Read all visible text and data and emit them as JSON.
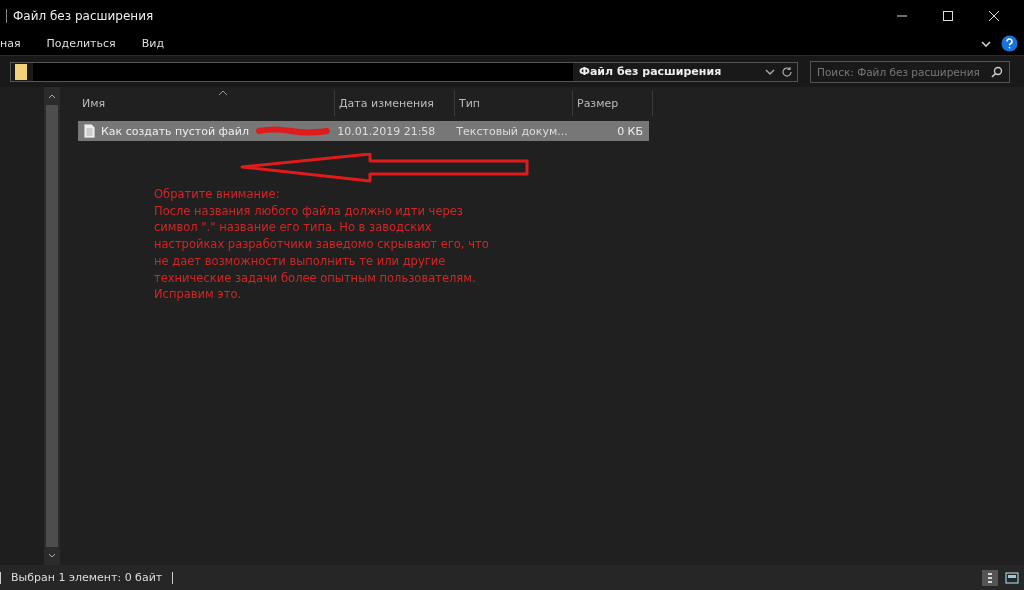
{
  "window": {
    "title": "Файл без расширения"
  },
  "ribbon_tabs": [
    {
      "label": "ная",
      "selected": false
    },
    {
      "label": "Поделиться",
      "selected": false
    },
    {
      "label": "Вид",
      "selected": false
    }
  ],
  "address_bar": {
    "current_folder": "Файл без расширения"
  },
  "search": {
    "placeholder": "Поиск: Файл без расширения"
  },
  "table": {
    "columns": [
      "Имя",
      "Дата изменения",
      "Тип",
      "Размер"
    ],
    "rows": [
      {
        "name": "Как создать пустой файл",
        "date": "10.01.2019 21:58",
        "type": "Текстовый докум...",
        "size": "0 КБ",
        "selected": true
      }
    ]
  },
  "annotation": {
    "lines": [
      "Обратите внимание:",
      "После названия любого файла должно идти через",
      "символ \".\" название его типа. Но в заводских",
      "настройках разработчики заведомо скрывают его, что",
      "не дает возможности выполнить те или другие",
      "технические задачи более опытным пользователям.",
      "Исправим это."
    ]
  },
  "status_bar": {
    "text": "Выбран 1 элемент: 0 байт"
  }
}
